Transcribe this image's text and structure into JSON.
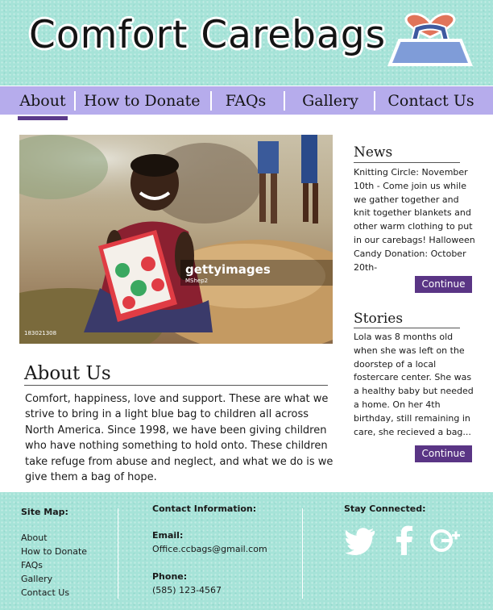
{
  "header": {
    "logo_text": "Comfort  Carebags",
    "logo_icon": "carebag-icon"
  },
  "nav": {
    "items": [
      {
        "label": "About",
        "active": true
      },
      {
        "label": "How to Donate",
        "active": false
      },
      {
        "label": "FAQs",
        "active": false
      },
      {
        "label": "Gallery",
        "active": false
      },
      {
        "label": "Contact Us",
        "active": false
      }
    ]
  },
  "hero": {
    "watermark": "gettyimages",
    "credit": "MShep2",
    "image_id": "183021308"
  },
  "about": {
    "title": "About Us",
    "body": "Comfort, happiness, love and support. These are what we strive to bring in a light blue bag to children all across North America. Since 1998, we have been giving children who have nothing something to hold onto. These children take refuge from abuse and neglect, and what we do is we give them a bag of hope."
  },
  "news": {
    "title": "News",
    "body": "Knitting Circle: November 10th - Come join us while we gather together and knit together blankets and other warm clothing to put in our carebags! Halloween Candy Donation: October 20th-",
    "button": "Continue"
  },
  "stories": {
    "title": "Stories",
    "body": "Lola was 8 months old when she was left on the doorstep of a local fostercare center. She was a healthy baby but needed a home. On her 4th birthday, still remaining in care, she recieved a bag...",
    "button": "Continue"
  },
  "footer": {
    "sitemap": {
      "heading": "Site Map:",
      "links": [
        "About",
        "How to Donate",
        "FAQs",
        "Gallery",
        "Contact Us"
      ]
    },
    "contact": {
      "heading": "Contact Information:",
      "email_label": "Email:",
      "email": "Office.ccbags@gmail.com",
      "phone_label": "Phone:",
      "phone": "(585) 123-4567"
    },
    "social": {
      "heading": "Stay Connected:",
      "icons": [
        "twitter-icon",
        "facebook-icon",
        "google-plus-icon"
      ]
    }
  },
  "colors": {
    "header_bg": "#a6e3d8",
    "nav_bg": "#b6acec",
    "accent": "#5a3585"
  }
}
